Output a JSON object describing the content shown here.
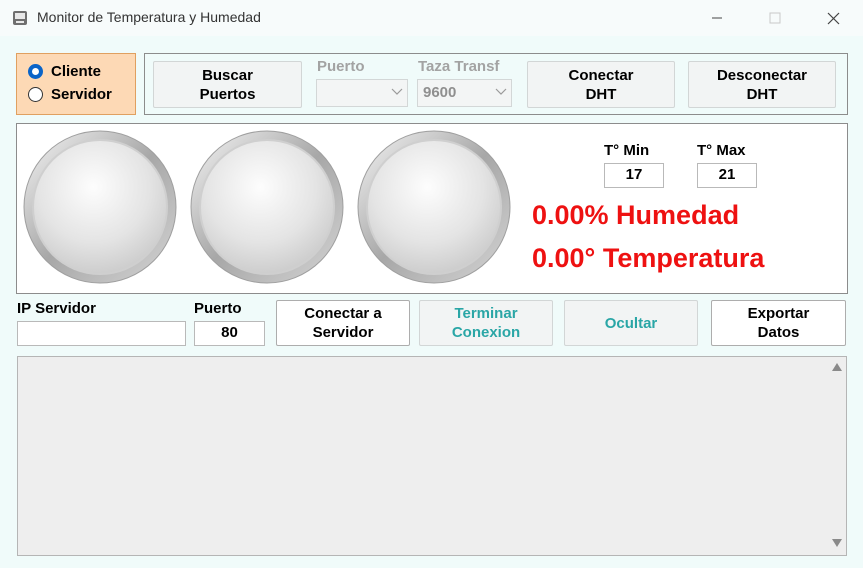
{
  "window": {
    "title": "Monitor de Temperatura y Humedad",
    "app_icon": "app-window-icon"
  },
  "mode": {
    "options": [
      "Cliente",
      "Servidor"
    ],
    "selected": "Cliente"
  },
  "toolbar": {
    "buscar_label": "Buscar\nPuertos",
    "puerto_label": "Puerto",
    "puerto_value": "",
    "taza_label": "Taza Transf",
    "taza_value": "9600",
    "conectar_dht_label": "Conectar\nDHT",
    "desconectar_dht_label": "Desconectar\nDHT"
  },
  "gauges": {
    "count": 3
  },
  "limits": {
    "tmin_label": "T° Min",
    "tmin_value": "17",
    "tmax_label": "T° Max",
    "tmax_value": "21"
  },
  "readings": {
    "humidity": "0.00% Humedad",
    "temperature": "0.00° Temperatura"
  },
  "network": {
    "ip_label": "IP Servidor",
    "ip_value": "",
    "port_label": "Puerto",
    "port_value": "80",
    "connect_label": "Conectar a\nServidor",
    "terminate_label": "Terminar\nConexion",
    "hide_label": "Ocultar",
    "export_label": "Exportar\nDatos"
  },
  "log": {
    "text": ""
  },
  "colors": {
    "accent_red": "#ee1111",
    "teal_text": "#2aa6a6",
    "radio_blue": "#0a64c8",
    "mode_bg": "#fdd9b5"
  }
}
